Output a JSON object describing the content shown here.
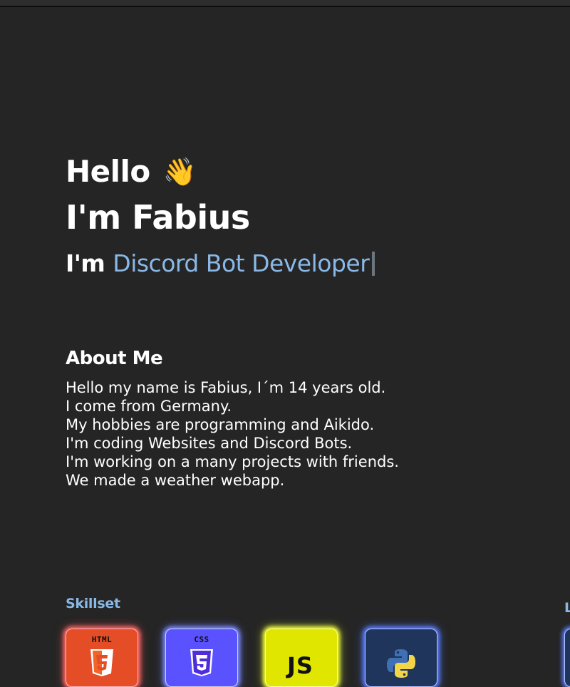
{
  "hero": {
    "hello": "Hello",
    "wave_icon": "waving-hand-icon",
    "wave_glyph": "👋",
    "name": "I'm Fabius",
    "role_prefix": "I'm",
    "role_highlight": "Discord Bot Developer"
  },
  "about": {
    "title": "About Me",
    "lines": [
      "Hello my name is Fabius, I´m 14 years old.",
      "I come from Germany.",
      "My hobbies are programming and Aikido.",
      "I'm coding Websites and Discord Bots.",
      "I'm working on a many projects with friends.",
      "We made a weather webapp."
    ]
  },
  "skills": {
    "title": "Skillset",
    "right_title_fragment": "L",
    "items": [
      {
        "label": "HTML",
        "icon": "html5-icon",
        "color": "#e44d26"
      },
      {
        "label": "CSS",
        "icon": "css3-icon",
        "color": "#5a52ff"
      },
      {
        "label": "JS",
        "icon": "javascript-icon",
        "color": "#e1e600"
      },
      {
        "label": "",
        "icon": "python-icon",
        "color": "#1f355c"
      }
    ]
  },
  "colors": {
    "background": "#252525",
    "accent": "#8ab8e6"
  }
}
